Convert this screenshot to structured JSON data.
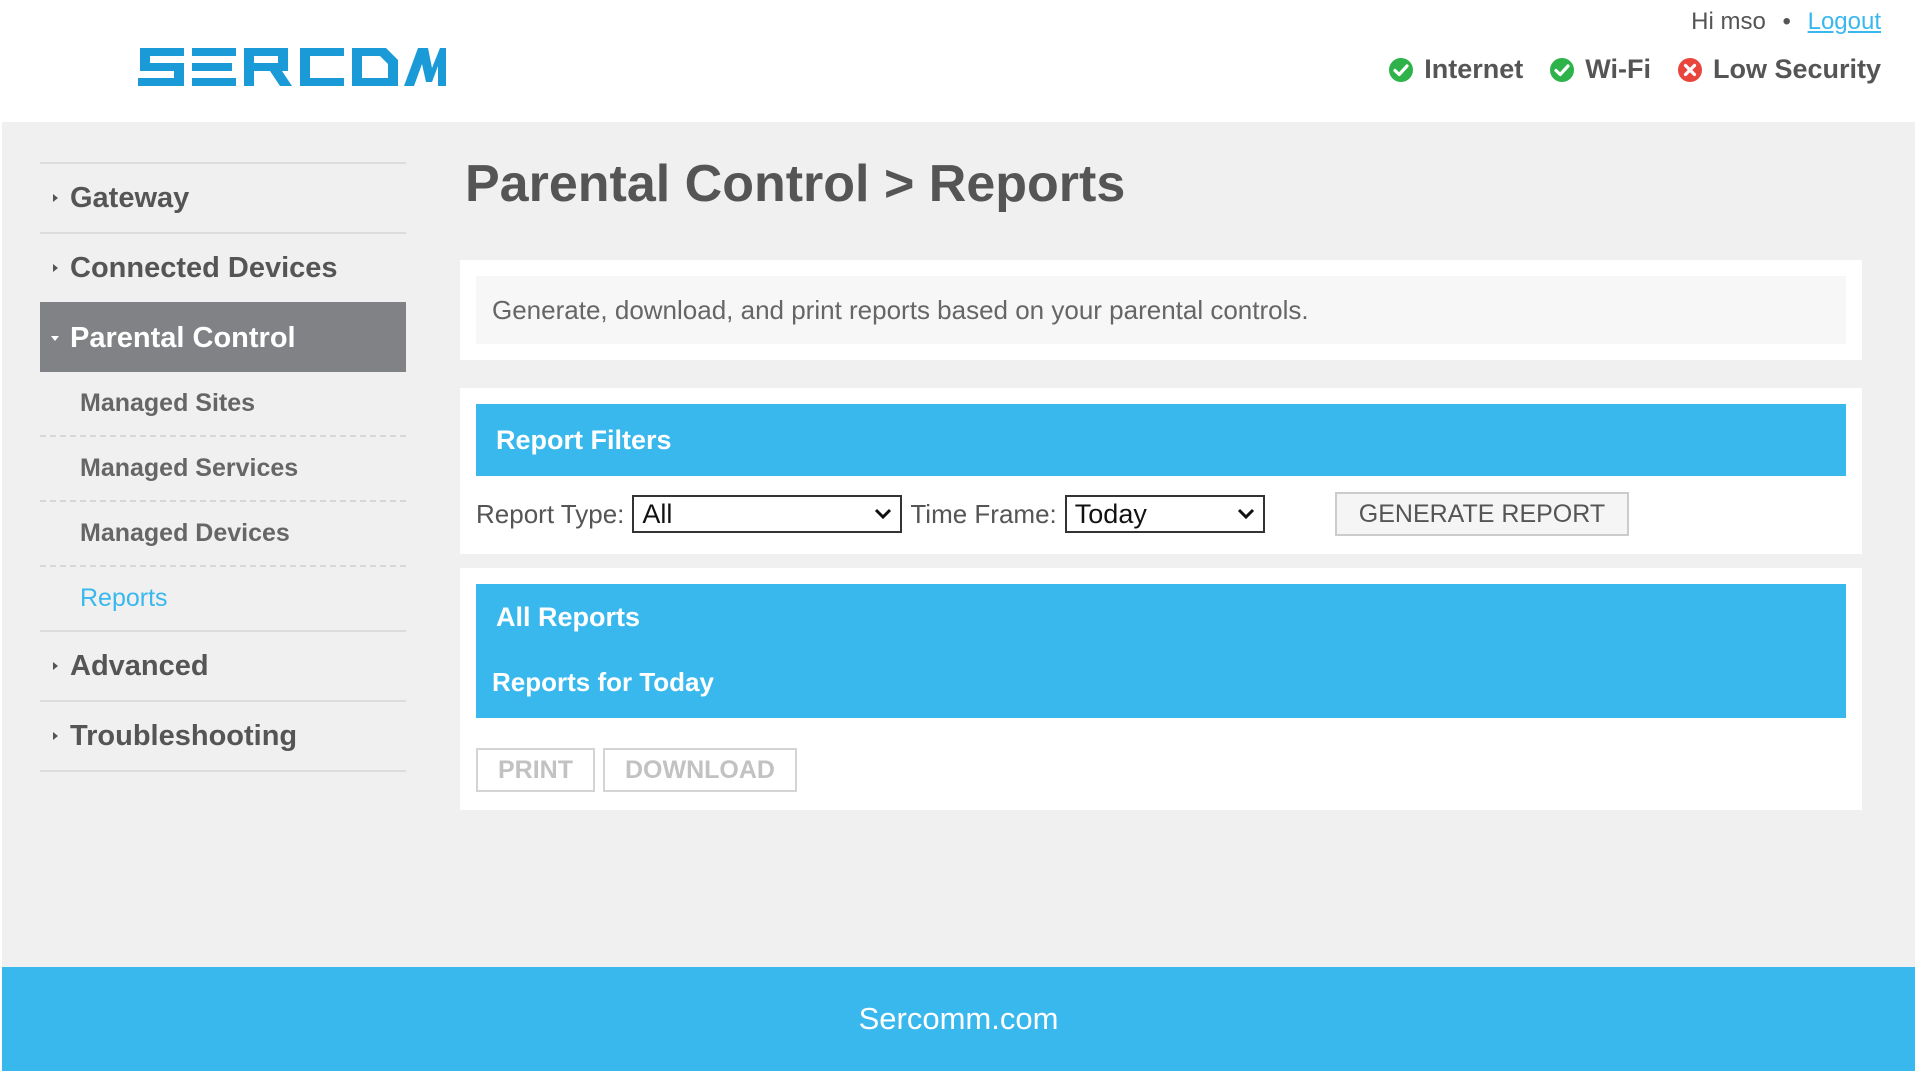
{
  "brand": {
    "logo_text": "SERCOMM",
    "color": "#1a9bd7"
  },
  "header": {
    "greeting": "Hi mso",
    "separator": "•",
    "logout_label": "Logout",
    "status": [
      {
        "label": "Internet",
        "state": "ok",
        "icon": "check-circle-icon",
        "color": "#2db34a"
      },
      {
        "label": "Wi-Fi",
        "state": "ok",
        "icon": "check-circle-icon",
        "color": "#2db34a"
      },
      {
        "label": "Low Security",
        "state": "error",
        "icon": "x-circle-icon",
        "color": "#e8453c"
      }
    ]
  },
  "sidebar": {
    "items": [
      {
        "label": "Gateway"
      },
      {
        "label": "Connected Devices"
      },
      {
        "label": "Parental Control",
        "expanded": true
      },
      {
        "label": "Advanced"
      },
      {
        "label": "Troubleshooting"
      }
    ],
    "subitems": [
      {
        "label": "Managed Sites"
      },
      {
        "label": "Managed Services"
      },
      {
        "label": "Managed Devices"
      },
      {
        "label": "Reports",
        "current": true
      }
    ]
  },
  "page": {
    "title": "Parental Control > Reports",
    "description": "Generate, download, and print reports based on your parental controls."
  },
  "filters": {
    "header": "Report Filters",
    "report_type_label": "Report Type:",
    "report_type_value": "All",
    "time_frame_label": "Time Frame:",
    "time_frame_value": "Today",
    "generate_label": "GENERATE REPORT"
  },
  "reports": {
    "header": "All Reports",
    "subheader": "Reports for Today",
    "print_label": "PRINT",
    "download_label": "DOWNLOAD"
  },
  "footer": {
    "text": "Sercomm.com"
  },
  "colors": {
    "accent": "#39b8ee",
    "nav_active": "#808285",
    "panel_bg": "#f0f0f0"
  }
}
